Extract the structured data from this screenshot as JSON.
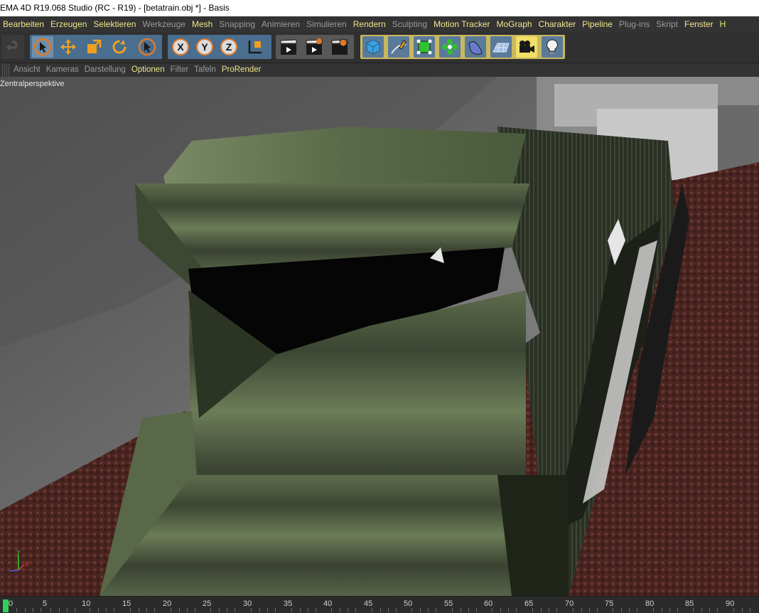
{
  "window": {
    "title": "EMA 4D R19.068 Studio (RC - R19) - [betatrain.obj *] - Basis"
  },
  "menu": [
    {
      "label": "Bearbeiten",
      "active": true
    },
    {
      "label": "Erzeugen",
      "active": true
    },
    {
      "label": "Selektieren",
      "active": true
    },
    {
      "label": "Werkzeuge",
      "active": false
    },
    {
      "label": "Mesh",
      "active": true
    },
    {
      "label": "Snapping",
      "active": false
    },
    {
      "label": "Animieren",
      "active": false
    },
    {
      "label": "Simulieren",
      "active": false
    },
    {
      "label": "Rendern",
      "active": true
    },
    {
      "label": "Sculpting",
      "active": false
    },
    {
      "label": "Motion Tracker",
      "active": true
    },
    {
      "label": "MoGraph",
      "active": true
    },
    {
      "label": "Charakter",
      "active": true
    },
    {
      "label": "Pipeline",
      "active": true
    },
    {
      "label": "Plug-ins",
      "active": false
    },
    {
      "label": "Skript",
      "active": false
    },
    {
      "label": "Fenster",
      "active": true
    },
    {
      "label": "H",
      "active": true
    }
  ],
  "toolbar": {
    "buttons": [
      {
        "name": "undo-icon"
      },
      {
        "name": "live-selection-icon"
      },
      {
        "name": "move-icon"
      },
      {
        "name": "scale-icon"
      },
      {
        "name": "rotate-icon"
      },
      {
        "name": "last-tool-icon"
      },
      {
        "name": "x-axis-lock-icon",
        "text": "X"
      },
      {
        "name": "y-axis-lock-icon",
        "text": "Y"
      },
      {
        "name": "z-axis-lock-icon",
        "text": "Z"
      },
      {
        "name": "coordinate-system-icon"
      },
      {
        "name": "render-view-icon"
      },
      {
        "name": "render-picture-viewer-icon"
      },
      {
        "name": "render-settings-icon"
      },
      {
        "name": "cube-primitive-icon"
      },
      {
        "name": "pen-spline-icon"
      },
      {
        "name": "subdivision-surface-icon"
      },
      {
        "name": "cloner-icon"
      },
      {
        "name": "deformer-icon"
      },
      {
        "name": "floor-environment-icon"
      },
      {
        "name": "camera-icon"
      },
      {
        "name": "light-icon"
      }
    ]
  },
  "viewport_menu": [
    {
      "label": "Ansicht",
      "active": false
    },
    {
      "label": "Kameras",
      "active": false
    },
    {
      "label": "Darstellung",
      "active": false
    },
    {
      "label": "Optionen",
      "active": true
    },
    {
      "label": "Filter",
      "active": false
    },
    {
      "label": "Tafeln",
      "active": false
    },
    {
      "label": "ProRender",
      "active": true
    }
  ],
  "viewport": {
    "label": "Zentralperspektive",
    "axis": {
      "x": "X",
      "y": "Y"
    }
  },
  "timeline": {
    "ticks": [
      "0",
      "5",
      "10",
      "15",
      "20",
      "25",
      "30",
      "35",
      "40",
      "45",
      "50",
      "55",
      "60",
      "65",
      "70",
      "75",
      "80",
      "85",
      "90"
    ],
    "current_frame": 0
  },
  "colors": {
    "menu_active": "#f0e68c",
    "menu_inactive": "#9a9a9a",
    "timeline_cursor": "#2fd05a"
  }
}
